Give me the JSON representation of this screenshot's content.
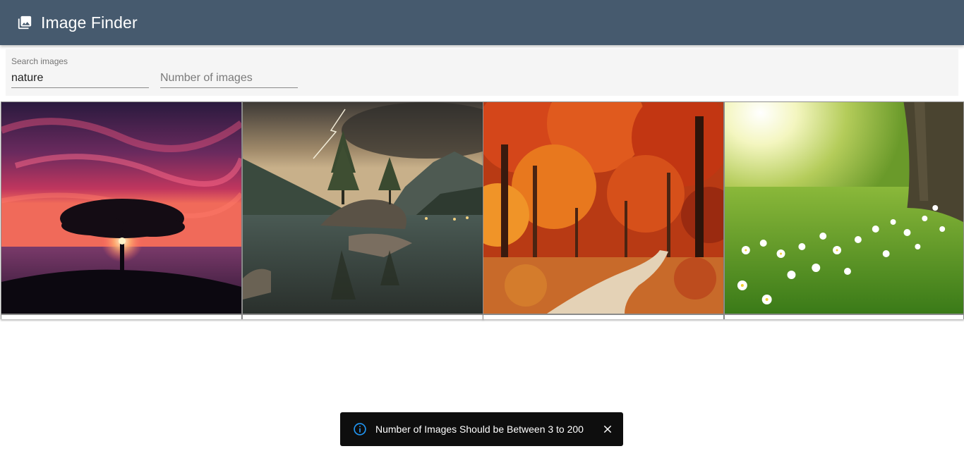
{
  "app": {
    "title": "Image Finder",
    "icon": "photo-library-icon"
  },
  "search": {
    "label": "Search images",
    "value": "nature",
    "count_placeholder": "Number of images",
    "count_value": ""
  },
  "images": [
    {
      "subject": "tree-sunset"
    },
    {
      "subject": "lake-island-lightning"
    },
    {
      "subject": "autumn-forest-path"
    },
    {
      "subject": "sunny-meadow-flowers"
    }
  ],
  "snackbar": {
    "message": "Number of Images Should be Between 3 to 200",
    "icon": "info-icon",
    "close_icon": "close-icon"
  },
  "colors": {
    "appbar": "#465a6e",
    "snackbar": "#0e0e0e",
    "info_accent": "#2196f3"
  }
}
